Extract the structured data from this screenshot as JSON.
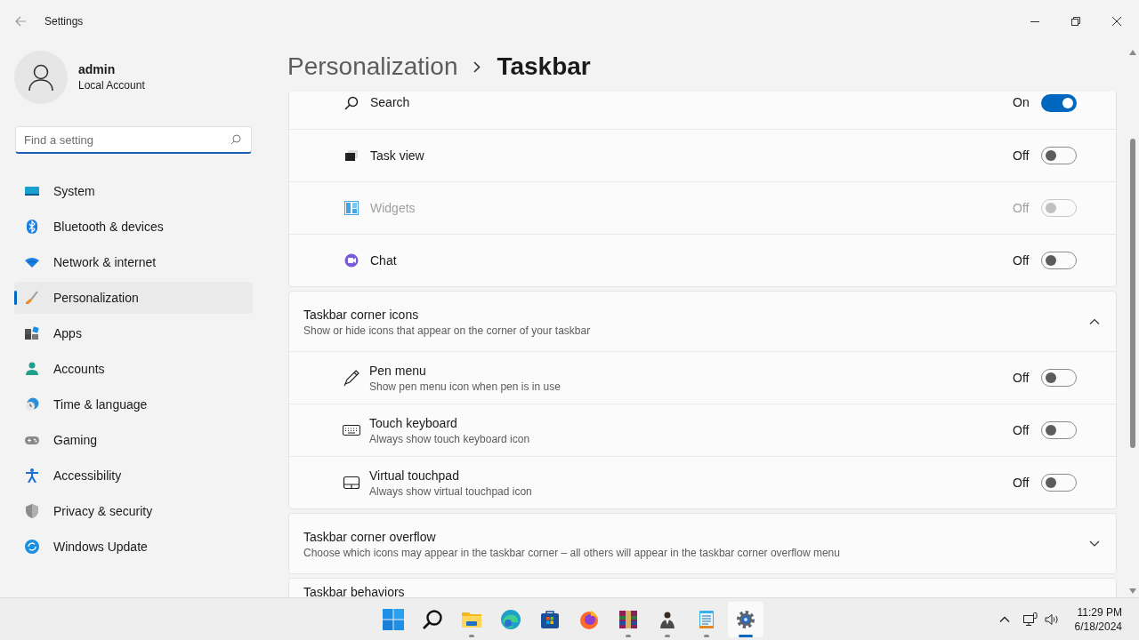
{
  "window": {
    "title": "Settings"
  },
  "account": {
    "name": "admin",
    "type": "Local Account"
  },
  "search": {
    "placeholder": "Find a setting"
  },
  "nav": [
    {
      "label": "System",
      "selected": false
    },
    {
      "label": "Bluetooth & devices",
      "selected": false
    },
    {
      "label": "Network & internet",
      "selected": false
    },
    {
      "label": "Personalization",
      "selected": true
    },
    {
      "label": "Apps",
      "selected": false
    },
    {
      "label": "Accounts",
      "selected": false
    },
    {
      "label": "Time & language",
      "selected": false
    },
    {
      "label": "Gaming",
      "selected": false
    },
    {
      "label": "Accessibility",
      "selected": false
    },
    {
      "label": "Privacy & security",
      "selected": false
    },
    {
      "label": "Windows Update",
      "selected": false
    }
  ],
  "breadcrumb": [
    "Personalization",
    "Taskbar"
  ],
  "taskbar_items": [
    {
      "label": "Search",
      "state_text": "On",
      "on": true,
      "disabled": false
    },
    {
      "label": "Task view",
      "state_text": "Off",
      "on": false,
      "disabled": false
    },
    {
      "label": "Widgets",
      "state_text": "Off",
      "on": false,
      "disabled": true
    },
    {
      "label": "Chat",
      "state_text": "Off",
      "on": false,
      "disabled": false
    }
  ],
  "corner_icons": {
    "title": "Taskbar corner icons",
    "description": "Show or hide icons that appear on the corner of your taskbar",
    "expanded": true,
    "items": [
      {
        "label": "Pen menu",
        "description": "Show pen menu icon when pen is in use",
        "state_text": "Off",
        "on": false
      },
      {
        "label": "Touch keyboard",
        "description": "Always show touch keyboard icon",
        "state_text": "Off",
        "on": false
      },
      {
        "label": "Virtual touchpad",
        "description": "Always show virtual touchpad icon",
        "state_text": "Off",
        "on": false
      }
    ]
  },
  "corner_overflow": {
    "title": "Taskbar corner overflow",
    "description": "Choose which icons may appear in the taskbar corner – all others will appear in the taskbar corner overflow menu",
    "expanded": false
  },
  "behaviors": {
    "title": "Taskbar behaviors"
  },
  "taskbar": {
    "apps": [
      {
        "running": false,
        "active": false
      },
      {
        "running": false,
        "active": false
      },
      {
        "running": true,
        "active": false
      },
      {
        "running": false,
        "active": false
      },
      {
        "running": false,
        "active": false
      },
      {
        "running": false,
        "active": false
      },
      {
        "running": true,
        "active": false
      },
      {
        "running": true,
        "active": false
      },
      {
        "running": true,
        "active": false
      },
      {
        "running": true,
        "active": true
      }
    ],
    "time": "11:29 PM",
    "date": "6/18/2024"
  }
}
